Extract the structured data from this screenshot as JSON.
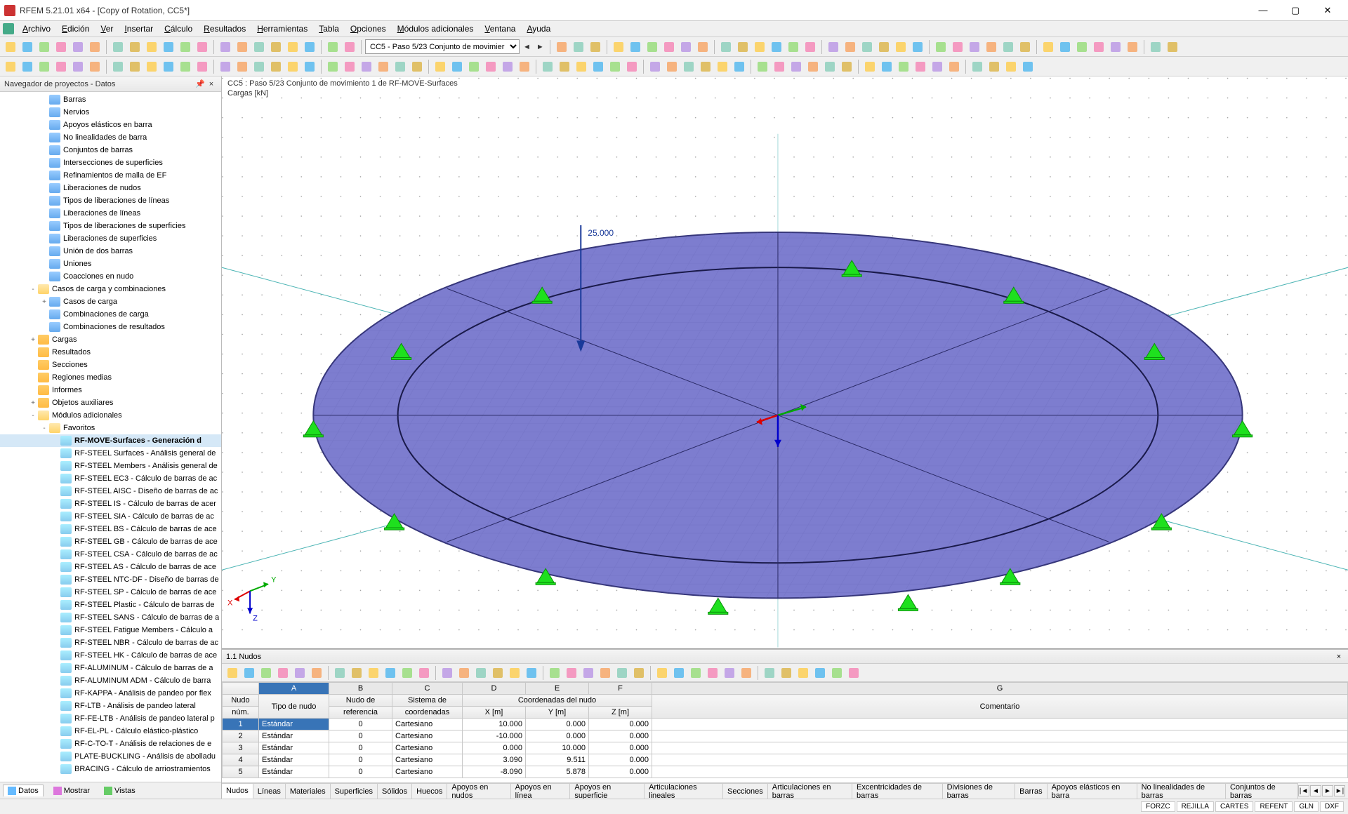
{
  "app": {
    "title": "RFEM 5.21.01 x64 - [Copy of Rotation, CC5*]"
  },
  "menu": [
    "Archivo",
    "Edición",
    "Ver",
    "Insertar",
    "Cálculo",
    "Resultados",
    "Herramientas",
    "Tabla",
    "Opciones",
    "Módulos adicionales",
    "Ventana",
    "Ayuda"
  ],
  "loadcase_combo": "CC5 - Paso 5/23 Conjunto de movimier",
  "navigator": {
    "title": "Navegador de proyectos - Datos",
    "tabs": {
      "datos": "Datos",
      "mostrar": "Mostrar",
      "vistas": "Vistas"
    },
    "tree": [
      {
        "indent": 3,
        "icon": "data",
        "label": "Barras"
      },
      {
        "indent": 3,
        "icon": "data",
        "label": "Nervios"
      },
      {
        "indent": 3,
        "icon": "data",
        "label": "Apoyos elásticos en barra"
      },
      {
        "indent": 3,
        "icon": "data",
        "label": "No linealidades de barra"
      },
      {
        "indent": 3,
        "icon": "data",
        "label": "Conjuntos de barras"
      },
      {
        "indent": 3,
        "icon": "data",
        "label": "Intersecciones de superficies"
      },
      {
        "indent": 3,
        "icon": "data",
        "label": "Refinamientos de malla de EF"
      },
      {
        "indent": 3,
        "icon": "data",
        "label": "Liberaciones de nudos"
      },
      {
        "indent": 3,
        "icon": "data",
        "label": "Tipos de liberaciones de líneas"
      },
      {
        "indent": 3,
        "icon": "data",
        "label": "Liberaciones de líneas"
      },
      {
        "indent": 3,
        "icon": "data",
        "label": "Tipos de liberaciones de superficies"
      },
      {
        "indent": 3,
        "icon": "data",
        "label": "Liberaciones de superficies"
      },
      {
        "indent": 3,
        "icon": "data",
        "label": "Unión de dos barras"
      },
      {
        "indent": 3,
        "icon": "data",
        "label": "Uniones"
      },
      {
        "indent": 3,
        "icon": "data",
        "label": "Coacciones en nudo"
      },
      {
        "indent": 2,
        "icon": "folder-o",
        "exp": "-",
        "label": "Casos de carga y combinaciones"
      },
      {
        "indent": 3,
        "icon": "data",
        "exp": "+",
        "label": "Casos de carga"
      },
      {
        "indent": 3,
        "icon": "data",
        "label": "Combinaciones de carga"
      },
      {
        "indent": 3,
        "icon": "data",
        "label": "Combinaciones de resultados"
      },
      {
        "indent": 2,
        "icon": "folder",
        "exp": "+",
        "label": "Cargas"
      },
      {
        "indent": 2,
        "icon": "folder",
        "label": "Resultados"
      },
      {
        "indent": 2,
        "icon": "folder",
        "label": "Secciones"
      },
      {
        "indent": 2,
        "icon": "folder",
        "label": "Regiones medias"
      },
      {
        "indent": 2,
        "icon": "folder",
        "label": "Informes"
      },
      {
        "indent": 2,
        "icon": "folder",
        "exp": "+",
        "label": "Objetos auxiliares"
      },
      {
        "indent": 2,
        "icon": "folder-o",
        "exp": "-",
        "label": "Módulos adicionales"
      },
      {
        "indent": 3,
        "icon": "folder-o",
        "exp": "-",
        "label": "Favoritos"
      },
      {
        "indent": 4,
        "icon": "module",
        "label": "RF-MOVE-Surfaces - Generación d",
        "bold": true,
        "sel": true
      },
      {
        "indent": 4,
        "icon": "module",
        "label": "RF-STEEL Surfaces - Análisis general de"
      },
      {
        "indent": 4,
        "icon": "module",
        "label": "RF-STEEL Members - Análisis general de"
      },
      {
        "indent": 4,
        "icon": "module",
        "label": "RF-STEEL EC3 - Cálculo de barras de ac"
      },
      {
        "indent": 4,
        "icon": "module",
        "label": "RF-STEEL AISC - Diseño de barras de ac"
      },
      {
        "indent": 4,
        "icon": "module",
        "label": "RF-STEEL IS - Cálculo de barras de acer"
      },
      {
        "indent": 4,
        "icon": "module",
        "label": "RF-STEEL SIA - Cálculo de barras de ac"
      },
      {
        "indent": 4,
        "icon": "module",
        "label": "RF-STEEL BS - Cálculo de barras de ace"
      },
      {
        "indent": 4,
        "icon": "module",
        "label": "RF-STEEL GB - Cálculo de barras de ace"
      },
      {
        "indent": 4,
        "icon": "module",
        "label": "RF-STEEL CSA - Cálculo de barras de ac"
      },
      {
        "indent": 4,
        "icon": "module",
        "label": "RF-STEEL AS - Cálculo de barras de ace"
      },
      {
        "indent": 4,
        "icon": "module",
        "label": "RF-STEEL NTC-DF - Diseño de barras de"
      },
      {
        "indent": 4,
        "icon": "module",
        "label": "RF-STEEL SP - Cálculo de barras de ace"
      },
      {
        "indent": 4,
        "icon": "module",
        "label": "RF-STEEL Plastic - Cálculo de barras de"
      },
      {
        "indent": 4,
        "icon": "module",
        "label": "RF-STEEL SANS - Cálculo de barras de a"
      },
      {
        "indent": 4,
        "icon": "module",
        "label": "RF-STEEL Fatigue Members - Cálculo a"
      },
      {
        "indent": 4,
        "icon": "module",
        "label": "RF-STEEL NBR - Cálculo de barras de ac"
      },
      {
        "indent": 4,
        "icon": "module",
        "label": "RF-STEEL HK - Cálculo de barras de ace"
      },
      {
        "indent": 4,
        "icon": "module",
        "label": "RF-ALUMINUM - Cálculo de barras de a"
      },
      {
        "indent": 4,
        "icon": "module",
        "label": "RF-ALUMINUM ADM - Cálculo de barra"
      },
      {
        "indent": 4,
        "icon": "module",
        "label": "RF-KAPPA - Análisis de pandeo por flex"
      },
      {
        "indent": 4,
        "icon": "module",
        "label": "RF-LTB - Análisis de pandeo lateral"
      },
      {
        "indent": 4,
        "icon": "module",
        "label": "RF-FE-LTB - Análisis de pandeo lateral p"
      },
      {
        "indent": 4,
        "icon": "module",
        "label": "RF-EL-PL - Cálculo elástico-plástico"
      },
      {
        "indent": 4,
        "icon": "module",
        "label": "RF-C-TO-T - Análisis de relaciones de e"
      },
      {
        "indent": 4,
        "icon": "module",
        "label": "PLATE-BUCKLING - Análisis de abolladu"
      },
      {
        "indent": 4,
        "icon": "module",
        "label": "BRACING - Cálculo de arriostramientos"
      }
    ]
  },
  "viewport": {
    "caption_line1": "CC5 : Paso 5/23 Conjunto de movimiento 1 de RF-MOVE-Surfaces",
    "caption_line2": "Cargas [kN]",
    "load_value": "25.000"
  },
  "table": {
    "title": "1.1 Nudos",
    "col_letters": [
      "A",
      "B",
      "C",
      "D",
      "E",
      "F",
      "G"
    ],
    "headers1": {
      "nudo": "Nudo",
      "coord": "Coordenadas del nudo"
    },
    "headers2": {
      "num": "núm.",
      "tipo": "Tipo de nudo",
      "ref": "Nudo de\nreferencia",
      "sist": "Sistema de\ncoordenadas",
      "x": "X [m]",
      "y": "Y [m]",
      "z": "Z [m]",
      "com": "Comentario"
    },
    "rows": [
      {
        "n": "1",
        "tipo": "Estándar",
        "ref": "0",
        "sist": "Cartesiano",
        "x": "10.000",
        "y": "0.000",
        "z": "0.000"
      },
      {
        "n": "2",
        "tipo": "Estándar",
        "ref": "0",
        "sist": "Cartesiano",
        "x": "-10.000",
        "y": "0.000",
        "z": "0.000"
      },
      {
        "n": "3",
        "tipo": "Estándar",
        "ref": "0",
        "sist": "Cartesiano",
        "x": "0.000",
        "y": "10.000",
        "z": "0.000"
      },
      {
        "n": "4",
        "tipo": "Estándar",
        "ref": "0",
        "sist": "Cartesiano",
        "x": "3.090",
        "y": "9.511",
        "z": "0.000"
      },
      {
        "n": "5",
        "tipo": "Estándar",
        "ref": "0",
        "sist": "Cartesiano",
        "x": "-8.090",
        "y": "5.878",
        "z": "0.000"
      }
    ],
    "tabs": [
      "Nudos",
      "Líneas",
      "Materiales",
      "Superficies",
      "Sólidos",
      "Huecos",
      "Apoyos en nudos",
      "Apoyos en línea",
      "Apoyos en superficie",
      "Articulaciones lineales",
      "Secciones",
      "Articulaciones en barras",
      "Excentricidades de barras",
      "Divisiones de barras",
      "Barras",
      "Apoyos elásticos en barra",
      "No linealidades de barras",
      "Conjuntos de barras"
    ]
  },
  "statusbar": {
    "cells": [
      "FORZC",
      "REJILLA",
      "CARTES",
      "REFENT",
      "GLN",
      "DXF"
    ]
  }
}
